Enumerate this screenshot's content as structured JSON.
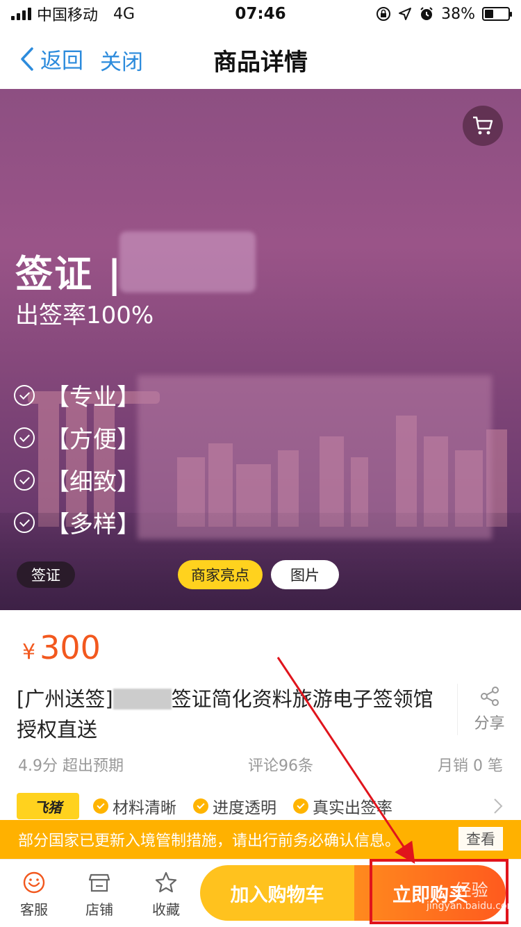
{
  "status_bar": {
    "carrier": "中国移动",
    "network": "4G",
    "time": "07:46",
    "battery": "38%",
    "battery_level": 0.38
  },
  "nav": {
    "back_label": "返回",
    "close_label": "关闭",
    "title": "商品详情"
  },
  "hero": {
    "title": "签证 |",
    "subtitle": "出签率100%",
    "features": [
      "【专业】",
      "【方便】",
      "【细致】",
      "【多样】"
    ],
    "tag": "签证",
    "tabs": [
      "商家亮点",
      "图片"
    ]
  },
  "product": {
    "currency": "¥",
    "price": "300",
    "title_prefix": "[广州送签]",
    "title_rest": "签证简化资料旅游电子签领馆授权直送",
    "share_label": "分享",
    "rating": "4.9分 超出预期",
    "comments": "评论96条",
    "monthly_sales": "月销 0 笔"
  },
  "badges": {
    "logo": "飞猪",
    "items": [
      "材料清晰",
      "进度透明",
      "真实出签率"
    ]
  },
  "notice": {
    "text": "部分国家已更新入境管制措施，请出行前务必确认信息。",
    "button": "查看"
  },
  "bottom_bar": {
    "service": "客服",
    "store": "店铺",
    "favorite": "收藏",
    "add_to_cart": "加入购物车",
    "buy_now": "立即购买"
  },
  "watermark": {
    "line1": "经验",
    "line2": "jingyan.baidu.com"
  },
  "colors": {
    "accent_blue": "#2c8bdc",
    "price_orange": "#f2581e",
    "yellow": "#ffc21e",
    "annotation_red": "#e0141c"
  }
}
